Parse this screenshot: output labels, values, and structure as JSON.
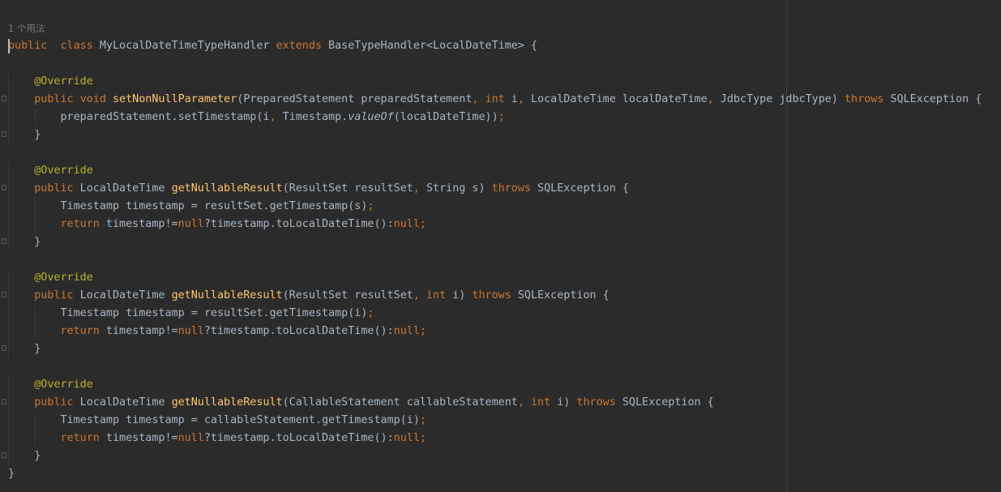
{
  "editor": {
    "usage_hint": "1 个用法",
    "colors": {
      "background": "#2b2b2b",
      "default_text": "#a9b7c6",
      "keyword": "#cc7832",
      "annotation": "#bbb529",
      "method_declaration": "#ffc66d",
      "hint_text": "#787878"
    },
    "lines": [
      [
        [
          "kw",
          "public"
        ],
        [
          "",
          "  "
        ],
        [
          "kw",
          "class"
        ],
        [
          "",
          " MyLocalDateTimeTypeHandler "
        ],
        [
          "kw",
          "extends"
        ],
        [
          "",
          " BaseTypeHandler<LocalDateTime> {"
        ]
      ],
      [],
      [
        [
          "",
          "    "
        ],
        [
          "ann",
          "@Override"
        ]
      ],
      [
        [
          "",
          "    "
        ],
        [
          "kw",
          "public"
        ],
        [
          "",
          " "
        ],
        [
          "kw",
          "void"
        ],
        [
          "",
          " "
        ],
        [
          "fn",
          "setNonNullParameter"
        ],
        [
          "",
          "(PreparedStatement preparedStatement"
        ],
        [
          "kw",
          ","
        ],
        [
          "",
          " "
        ],
        [
          "kw",
          "int"
        ],
        [
          "",
          " i"
        ],
        [
          "kw",
          ","
        ],
        [
          "",
          " LocalDateTime localDateTime"
        ],
        [
          "kw",
          ","
        ],
        [
          "",
          " JdbcType jdbcType) "
        ],
        [
          "kw",
          "throws"
        ],
        [
          "",
          " SQLException {"
        ]
      ],
      [
        [
          "",
          "        preparedStatement.setTimestamp(i"
        ],
        [
          "kw",
          ","
        ],
        [
          "",
          " Timestamp."
        ],
        [
          "it",
          "valueOf"
        ],
        [
          "",
          "(localDateTime))"
        ],
        [
          "kw",
          ";"
        ]
      ],
      [
        [
          "",
          "    }"
        ]
      ],
      [],
      [
        [
          "",
          "    "
        ],
        [
          "ann",
          "@Override"
        ]
      ],
      [
        [
          "",
          "    "
        ],
        [
          "kw",
          "public"
        ],
        [
          "",
          " LocalDateTime "
        ],
        [
          "fn",
          "getNullableResult"
        ],
        [
          "",
          "(ResultSet resultSet"
        ],
        [
          "kw",
          ","
        ],
        [
          "",
          " String s) "
        ],
        [
          "kw",
          "throws"
        ],
        [
          "",
          " SQLException {"
        ]
      ],
      [
        [
          "",
          "        Timestamp timestamp = resultSet.getTimestamp(s)"
        ],
        [
          "kw",
          ";"
        ]
      ],
      [
        [
          "",
          "        "
        ],
        [
          "kw",
          "return"
        ],
        [
          "",
          " timestamp!="
        ],
        [
          "kw",
          "null"
        ],
        [
          "",
          "?timestamp.toLocalDateTime():"
        ],
        [
          "kw",
          "null;"
        ]
      ],
      [
        [
          "",
          "    }"
        ]
      ],
      [],
      [
        [
          "",
          "    "
        ],
        [
          "ann",
          "@Override"
        ]
      ],
      [
        [
          "",
          "    "
        ],
        [
          "kw",
          "public"
        ],
        [
          "",
          " LocalDateTime "
        ],
        [
          "fn",
          "getNullableResult"
        ],
        [
          "",
          "(ResultSet resultSet"
        ],
        [
          "kw",
          ","
        ],
        [
          "",
          " "
        ],
        [
          "kw",
          "int"
        ],
        [
          "",
          " i) "
        ],
        [
          "kw",
          "throws"
        ],
        [
          "",
          " SQLException {"
        ]
      ],
      [
        [
          "",
          "        Timestamp timestamp = resultSet.getTimestamp(i)"
        ],
        [
          "kw",
          ";"
        ]
      ],
      [
        [
          "",
          "        "
        ],
        [
          "kw",
          "return"
        ],
        [
          "",
          " timestamp!="
        ],
        [
          "kw",
          "null"
        ],
        [
          "",
          "?timestamp.toLocalDateTime():"
        ],
        [
          "kw",
          "null;"
        ]
      ],
      [
        [
          "",
          "    }"
        ]
      ],
      [],
      [
        [
          "",
          "    "
        ],
        [
          "ann",
          "@Override"
        ]
      ],
      [
        [
          "",
          "    "
        ],
        [
          "kw",
          "public"
        ],
        [
          "",
          " LocalDateTime "
        ],
        [
          "fn",
          "getNullableResult"
        ],
        [
          "",
          "(CallableStatement callableStatement"
        ],
        [
          "kw",
          ","
        ],
        [
          "",
          " "
        ],
        [
          "kw",
          "int"
        ],
        [
          "",
          " i) "
        ],
        [
          "kw",
          "throws"
        ],
        [
          "",
          " SQLException {"
        ]
      ],
      [
        [
          "",
          "        Timestamp timestamp = callableStatement.getTimestamp(i)"
        ],
        [
          "kw",
          ";"
        ]
      ],
      [
        [
          "",
          "        "
        ],
        [
          "kw",
          "return"
        ],
        [
          "",
          " timestamp!="
        ],
        [
          "kw",
          "null"
        ],
        [
          "",
          "?timestamp.toLocalDateTime():"
        ],
        [
          "kw",
          "null;"
        ]
      ],
      [
        [
          "",
          "    }"
        ]
      ],
      [
        [
          "",
          "}"
        ]
      ]
    ]
  }
}
